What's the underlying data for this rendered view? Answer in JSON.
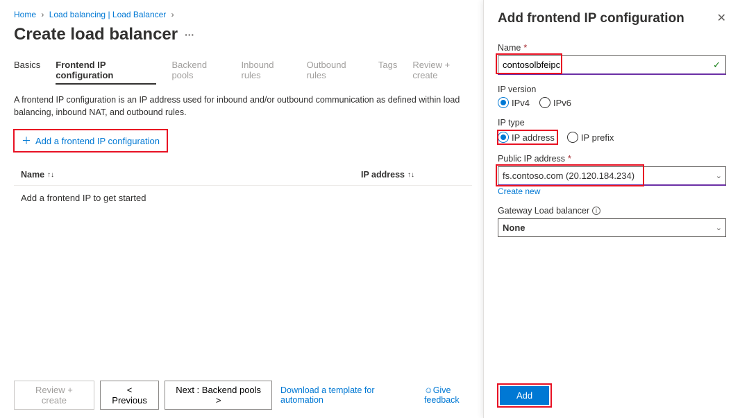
{
  "breadcrumb": {
    "home": "Home",
    "mid": "Load balancing | Load Balancer"
  },
  "page_title": "Create load balancer",
  "tabs": {
    "basics": "Basics",
    "frontend": "Frontend IP configuration",
    "backend": "Backend pools",
    "inbound": "Inbound rules",
    "outbound": "Outbound rules",
    "tags": "Tags",
    "review": "Review + create"
  },
  "desc": "A frontend IP configuration is an IP address used for inbound and/or outbound communication as defined within load balancing, inbound NAT, and outbound rules.",
  "add_frontend_btn": "Add a frontend IP configuration",
  "table": {
    "col_name": "Name",
    "col_ip": "IP address",
    "sort_symbol": "↑↓",
    "empty_msg": "Add a frontend IP to get started"
  },
  "footer": {
    "review": "Review + create",
    "prev": "< Previous",
    "next": "Next : Backend pools >",
    "download": "Download a template for automation",
    "feedback": "Give feedback"
  },
  "panel": {
    "title": "Add frontend IP configuration",
    "name_label": "Name",
    "name_value": "contosolbfeipc",
    "ip_version_label": "IP version",
    "ipv4": "IPv4",
    "ipv6": "IPv6",
    "ip_type_label": "IP type",
    "ip_address": "IP address",
    "ip_prefix": "IP prefix",
    "public_ip_label": "Public IP address",
    "public_ip_value": "fs.contoso.com (20.120.184.234)",
    "create_new": "Create new",
    "gateway_lb_label": "Gateway Load balancer",
    "gateway_value": "None",
    "add_btn": "Add"
  }
}
